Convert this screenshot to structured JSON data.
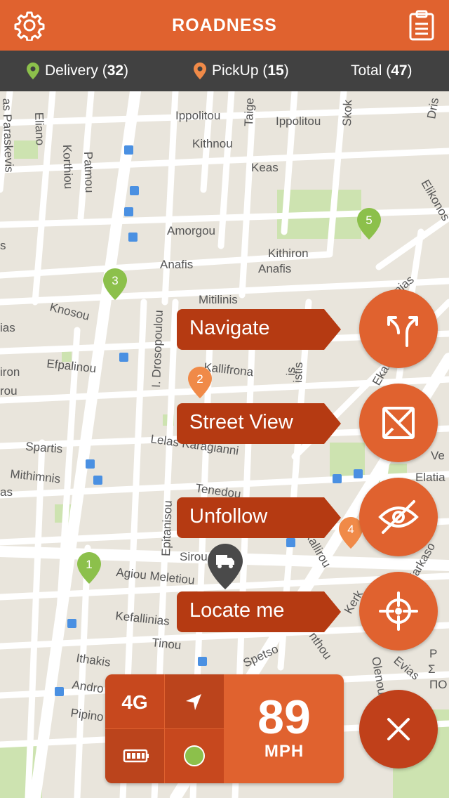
{
  "app": {
    "title": "ROADNESS"
  },
  "icons": {
    "settings": "gear-icon",
    "tasks": "clipboard-icon"
  },
  "colors": {
    "accent": "#e0622f",
    "accent_dark": "#b53a12",
    "delivery": "#8cc04b",
    "pickup": "#f08a48",
    "statsbar": "#414141"
  },
  "stats": {
    "delivery": {
      "label": "Delivery",
      "count": "32"
    },
    "pickup": {
      "label": "PickUp",
      "count": "15"
    },
    "total": {
      "label": "Total",
      "count": "47"
    }
  },
  "actions": [
    {
      "label": "Navigate",
      "icon": "route-split-icon"
    },
    {
      "label": "Street View",
      "icon": "street-view-icon"
    },
    {
      "label": "Unfollow",
      "icon": "eye-off-icon"
    },
    {
      "label": "Locate me",
      "icon": "crosshair-icon"
    }
  ],
  "close_icon": "close-icon",
  "hud": {
    "network": "4G",
    "speed": "89",
    "speed_unit": "MPH",
    "battery_icon": "battery-icon",
    "location_icon": "location-arrow-icon",
    "gps_status_color": "#8cc04b"
  },
  "map": {
    "streets": [
      "Ippolitou",
      "Ippolitou",
      "Taige",
      "Skok",
      "Dris",
      "Kithnou",
      "Keas",
      "Elikonos",
      "Amorgou",
      "Kithiron",
      "Anafis",
      "Anafis",
      "Mitilinis",
      "onias",
      "Knosou",
      "Efpalinou",
      "Kallifrona",
      "I. Drosopoulou",
      "Spartis",
      "Lelas Karagianni",
      "Mithimnis",
      "Tenedou",
      "Epitanisou",
      "Agiou Meletiou",
      "Kefallinias",
      "Tinou",
      "Ithakis",
      "Andro",
      "Pipino",
      "Spetso",
      "Elatia",
      "Ve",
      "Evias",
      "Olenou",
      "Eliano",
      "Korthiou",
      "Patmou",
      "as Paraskevis",
      "Sirou",
      "Kallirou",
      "Ekat",
      "ias",
      "iron",
      "rou",
      "is",
      "Farkaso",
      "Kerk",
      "nthou",
      "Σ",
      "ΠΟ",
      "istis",
      "s",
      "as",
      "Ρ"
    ],
    "pins": [
      {
        "number": "1",
        "type": "delivery"
      },
      {
        "number": "2",
        "type": "pickup"
      },
      {
        "number": "3",
        "type": "delivery"
      },
      {
        "number": "4",
        "type": "pickup"
      },
      {
        "number": "5",
        "type": "delivery"
      }
    ],
    "vehicle_icon": "truck-icon"
  }
}
